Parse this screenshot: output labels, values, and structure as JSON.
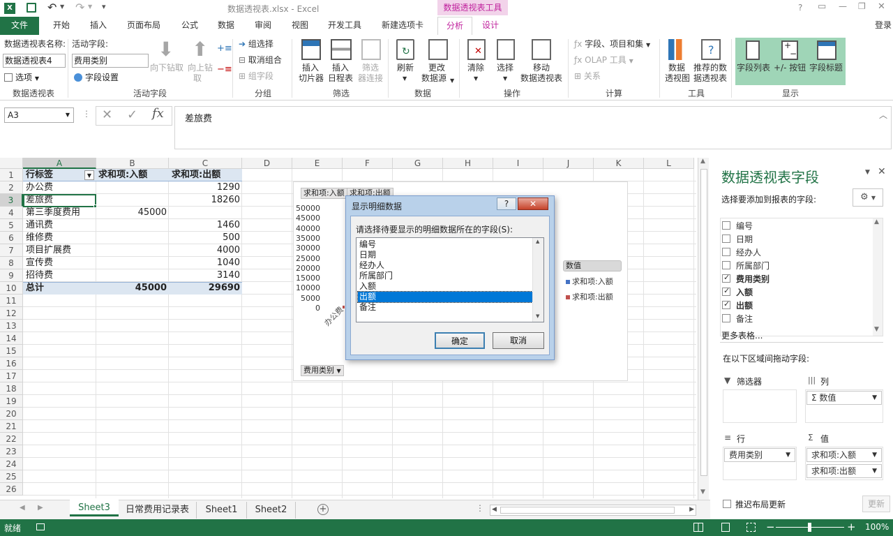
{
  "window": {
    "title": "数据透视表.xlsx - Excel",
    "context_tool": "数据透视表工具",
    "help": "?",
    "restore": "▭",
    "minimize": "—",
    "maximize": "❐",
    "close": "✕"
  },
  "quick_access": {
    "undo": "↶",
    "redo": "↷",
    "customize": "▾"
  },
  "tabs": {
    "file": "文件",
    "home": "开始",
    "insert": "插入",
    "layout": "页面布局",
    "formulas": "公式",
    "data": "数据",
    "review": "审阅",
    "view": "视图",
    "developer": "开发工具",
    "newtab": "新建选项卡",
    "analyze": "分析",
    "design": "设计",
    "signin": "登录"
  },
  "ribbon": {
    "pt_name_label": "数据透视表名称:",
    "pt_name_value": "数据透视表4",
    "options": "选项",
    "group_pt": "数据透视表",
    "active_field_label": "活动字段:",
    "active_field_value": "费用类别",
    "field_settings": "字段设置",
    "drill_down": "向下钻取",
    "drill_up_1": "向上钻",
    "drill_up_2": "取",
    "group_active": "活动字段",
    "group_selection": "组选择",
    "ungroup": "取消组合",
    "group_field": "组字段",
    "group_group": "分组",
    "slicer_1": "插入",
    "slicer_2": "切片器",
    "timeline_1": "插入",
    "timeline_2": "日程表",
    "filter_conn_1": "筛选",
    "filter_conn_2": "器连接",
    "group_filter": "筛选",
    "refresh": "刷新",
    "change_src_1": "更改",
    "change_src_2": "数据源",
    "group_data": "数据",
    "clear": "清除",
    "select": "选择",
    "move_1": "移动",
    "move_2": "数据透视表",
    "group_actions": "操作",
    "fields_items": "字段、项目和集",
    "olap": "OLAP 工具",
    "relations": "关系",
    "group_calc": "计算",
    "pivotchart_1": "数据",
    "pivotchart_2": "透视图",
    "recommended_1": "推荐的数",
    "recommended_2": "据透视表",
    "group_tools": "工具",
    "field_list": "字段列表",
    "plus_minus": "+/- 按钮",
    "field_headers": "字段标题",
    "group_show": "显示"
  },
  "formula_bar": {
    "name_box": "A3",
    "fx": "fx",
    "cancel": "✕",
    "enter": "✓",
    "content": "差旅费"
  },
  "columns": [
    "A",
    "B",
    "C",
    "D",
    "E",
    "F",
    "G",
    "H",
    "I",
    "J",
    "K",
    "L"
  ],
  "rows": [
    "1",
    "2",
    "3",
    "4",
    "5",
    "6",
    "7",
    "8",
    "9",
    "10",
    "11",
    "12",
    "13",
    "14",
    "15",
    "16",
    "17",
    "18",
    "19",
    "20",
    "21",
    "22",
    "23",
    "24",
    "25",
    "26"
  ],
  "pivot": {
    "header": [
      "行标签",
      "求和项:入额",
      "求和项:出额"
    ],
    "data": [
      [
        "办公费",
        "",
        "1290"
      ],
      [
        "差旅费",
        "",
        "18260"
      ],
      [
        "第三季度费用",
        "45000",
        ""
      ],
      [
        "通讯费",
        "",
        "1460"
      ],
      [
        "维修费",
        "",
        "500"
      ],
      [
        "项目扩展费",
        "",
        "4000"
      ],
      [
        "宣传费",
        "",
        "1040"
      ],
      [
        "招待费",
        "",
        "3140"
      ]
    ],
    "total": [
      "总计",
      "45000",
      "29690"
    ]
  },
  "chart": {
    "field_btn_in": "求和项:入额",
    "field_btn_out": "求和项:出额",
    "y_ticks": [
      "50000",
      "45000",
      "40000",
      "35000",
      "30000",
      "25000",
      "20000",
      "15000",
      "10000",
      "5000",
      "0"
    ],
    "x_first": "办公费",
    "legend_title": "数值",
    "legend_1": "求和项:入额",
    "legend_2": "求和项:出额",
    "axis_field": "费用类别",
    "color_in": "#4472c4",
    "color_out": "#c0504d"
  },
  "dialog": {
    "title": "显示明细数据",
    "prompt": "请选择待要显示的明细数据所在的字段(S):",
    "items": [
      "编号",
      "日期",
      "经办人",
      "所属部门",
      "入额",
      "出额",
      "备注"
    ],
    "selected_index": 5,
    "ok": "确定",
    "cancel": "取消",
    "help": "?",
    "close": "✕"
  },
  "panel": {
    "title": "数据透视表字段",
    "subtitle": "选择要添加到报表的字段:",
    "fields": [
      {
        "name": "编号",
        "checked": false
      },
      {
        "name": "日期",
        "checked": false
      },
      {
        "name": "经办人",
        "checked": false
      },
      {
        "name": "所属部门",
        "checked": false
      },
      {
        "name": "费用类别",
        "checked": true
      },
      {
        "name": "入额",
        "checked": true
      },
      {
        "name": "出额",
        "checked": true
      },
      {
        "name": "备注",
        "checked": false
      }
    ],
    "more": "更多表格...",
    "drag_hint": "在以下区域间拖动字段:",
    "filters": "筛选器",
    "columns": "列",
    "columns_item": "Σ 数值",
    "rows": "行",
    "rows_item": "费用类别",
    "values": "值",
    "values_item_1": "求和项:入额",
    "values_item_2": "求和项:出额",
    "defer": "推迟布局更新",
    "update": "更新"
  },
  "sheets": [
    "Sheet3",
    "日常费用记录表",
    "Sheet1",
    "Sheet2"
  ],
  "status": {
    "ready": "就绪",
    "zoom": "100%",
    "minus": "−",
    "plus": "+"
  },
  "colors": {
    "excel_green": "#217346",
    "accent_pink": "#c0229d",
    "selection_blue": "#0078d7"
  }
}
